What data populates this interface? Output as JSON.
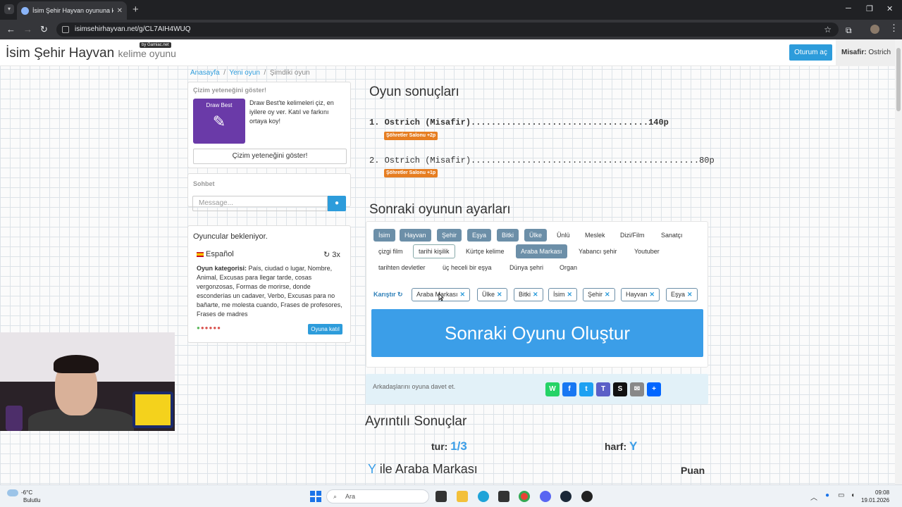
{
  "browser": {
    "tab_title": "İsim Şehir Hayvan oyununa katıl",
    "url": "isimsehirhayvan.net/g/CL7AIH4WUQ"
  },
  "site": {
    "logo_main": "İsim Şehir Hayvan",
    "logo_sub": "kelime oyunu",
    "logo_badge": "by Gamiac.net",
    "login_label": "Oturum aç",
    "guest_label": "Misafir:",
    "guest_name": "Ostrich"
  },
  "breadcrumb": {
    "home": "Anasayfa",
    "new_game": "Yeni oyun",
    "current": "Şimdiki oyun"
  },
  "sidebar": {
    "ad": {
      "title": "Çizim yeteneğini göster!",
      "image_text": "Draw Best",
      "text": "Draw Best'te kelimeleri çiz, en iyilere oy ver. Katıl ve farkını ortaya koy!",
      "button": "Çizim yeteneğini göster!"
    },
    "chat": {
      "title": "Sohbet",
      "placeholder": "Message..."
    },
    "players": {
      "title": "Oyuncular bekleniyor.",
      "language": "Español",
      "rounds": "3x",
      "category_label": "Oyun kategorisi:",
      "categories": "País, ciudad o lugar, Nombre, Animal, Excusas para llegar tarde, cosas vergonzosas, Formas de morirse, donde esconderías un cadaver, Verbo, Excusas para no bañarte, me molesta cuando, Frases de profesores, Frases de madres",
      "join_button": "Oyuna katıl"
    }
  },
  "results": {
    "title": "Oyun sonuçları",
    "rows": [
      {
        "line": "1. Ostrich (Misafir)...................................140p",
        "badge": "Şöhretler Salonu +2p"
      },
      {
        "line": "2. Ostrich (Misafir).............................................80p",
        "badge": "Şöhretler Salonu +1p"
      }
    ]
  },
  "next_settings": {
    "title": "Sonraki oyunun ayarları",
    "categories": [
      "İsim",
      "Hayvan",
      "Şehir",
      "Eşya",
      "Bitki",
      "Ülke",
      "Ünlü",
      "Meslek",
      "Dizi/Film",
      "Sanatçı",
      "çizgi film",
      "tarihi kişilik",
      "Kürtçe kelime",
      "Araba Markası",
      "Yabancı şehir",
      "Youtuber",
      "tarihten devletler",
      "üç heceli bir eşya",
      "Dünya şehri",
      "Organ"
    ],
    "shuffle_label": "Karıştır",
    "chips": [
      "Araba Markası",
      "Ülke",
      "Bitki",
      "İsim",
      "Şehir",
      "Hayvan",
      "Eşya"
    ],
    "create_button": "Sonraki Oyunu Oluştur"
  },
  "invite": {
    "text": "Arkadaşlarını oyuna davet et."
  },
  "details": {
    "title": "Ayrıntılı Sonuçlar",
    "round_label": "tur:",
    "round_value": "1/3",
    "letter_label": "harf:",
    "letter_value": "Y",
    "category_letter": "Y",
    "category_suffix": " ile Araba Markası",
    "score_label": "Puan"
  },
  "taskbar": {
    "temp": "-6°C",
    "weather": "Bulutlu",
    "search": "Ara",
    "time": "09:08",
    "date": "19.01.2026"
  },
  "colors": {
    "accent": "#2d9cdb",
    "selected_category": "#6c8fa8",
    "badge": "#e67e22",
    "create_button": "#3b9ee8"
  }
}
